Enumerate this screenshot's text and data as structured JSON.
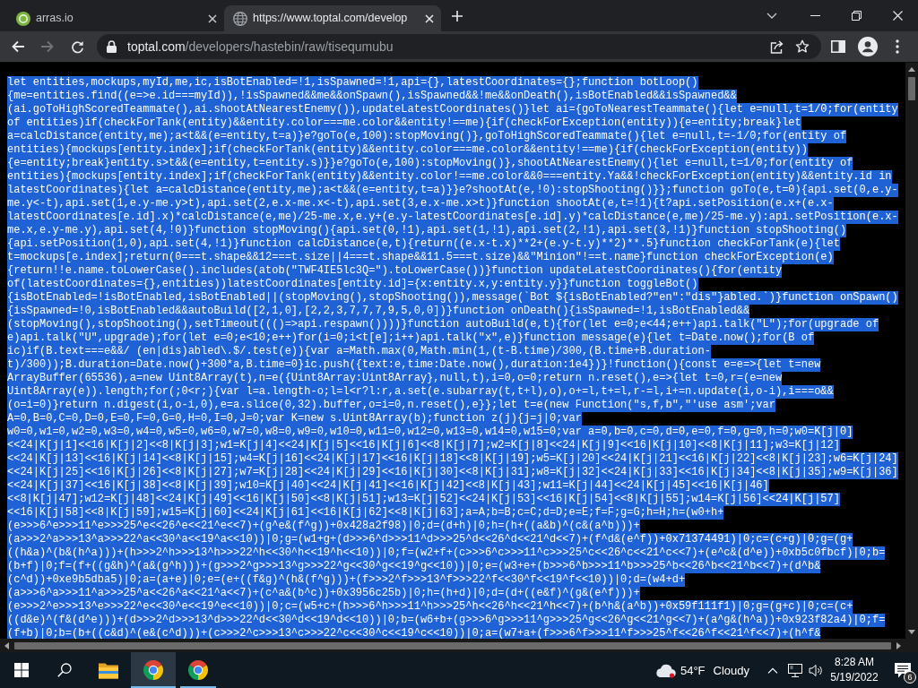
{
  "browser": {
    "tabs": [
      {
        "title": "arras.io",
        "kind": "app",
        "selected": false
      },
      {
        "title": "https://www.toptal.com/develop",
        "kind": "web",
        "selected": true
      }
    ],
    "back": {
      "disabled": false
    },
    "forward": {
      "disabled": true
    },
    "address": {
      "host": "toptal.com",
      "path": "/developers/hastebin/raw/tisequmubu"
    }
  },
  "code": {
    "selected": true,
    "lines": [
      "let entities,mockups,myId,me,ic,isBotEnabled=!1,isSpawned=!1,api={},latestCoordinates={};function botLoop()",
      "{me=entities.find((e=>e.id===myId)),!isSpawned&&me&&onSpawn(),isSpawned&&!me&&onDeath(),isBotEnabled&&isSpawned&&",
      "(ai.goToHighScoredTeammate(),ai.shootAtNearestEnemy()),updateLatestCoordinates()}let ai={goToNearestTeammate(){let e=null,t=1/0;for(entity",
      "of entities)if(checkForTank(entity)&&entity.color===me.color&&entity!==me){if(checkForException(entity)){e=entity;break}let",
      "a=calcDistance(entity,me);a<t&&(e=entity,t=a)}e?goTo(e,100):stopMoving()},goToHighScoredTeammate(){let e=null,t=-1/0;for(entity of",
      "entities){mockups[entity.index];if(checkForTank(entity)&&entity.color===me.color&&entity!==me){if(checkForException(entity))",
      "{e=entity;break}entity.s>t&&(e=entity,t=entity.s)}}e?goTo(e,100):stopMoving()},shootAtNearestEnemy(){let e=null,t=1/0;for(entity of",
      "entities){mockups[entity.index];if(checkForTank(entity)&&entity.color!==me.color&&0===entity.Ya&&!checkForException(entity)&&entity.id in",
      "latestCoordinates){let a=calcDistance(entity,me);a<t&&(e=entity,t=a)}}e?shootAt(e,!0):stopShooting()}};function goTo(e,t=0){api.set(0,e.y-",
      "me.y<-t),api.set(1,e.y-me.y>t),api.set(2,e.x-me.x<-t),api.set(3,e.x-me.x>t)}function shootAt(e,t=!1){t?api.setPosition(e.x+(e.x-",
      "latestCoordinates[e.id].x)*calcDistance(e,me)/25-me.x,e.y+(e.y-latestCoordinates[e.id].y)*calcDistance(e,me)/25-me.y):api.setPosition(e.x-",
      "me.x,e.y-me.y),api.set(4,!0)}function stopMoving(){api.set(0,!1),api.set(1,!1),api.set(2,!1),api.set(3,!1)}function stopShooting()",
      "{api.setPosition(1,0),api.set(4,!1)}function calcDistance(e,t){return((e.x-t.x)**2+(e.y-t.y)**2)**.5}function checkForTank(e){let",
      "t=mockups[e.index];return(0===t.shape&&12===t.size||4===t.shape&&11.5===t.size)&&\"Minion\"!==t.name}function checkForException(e)",
      "{return!!e.name.toLowerCase().includes(atob(\"TWF4IE5lc3Q=\").toLowerCase())}function updateLatestCoordinates(){for(entity",
      "of(latestCoordinates={},entities))latestCoordinates[entity.id]={x:entity.x,y:entity.y}}function toggleBot()",
      "{isBotEnabled=!isBotEnabled,isBotEnabled||(stopMoving(),stopShooting()),message(`Bot ${isBotEnabled?\"en\":\"dis\"}abled.`)}function onSpawn()",
      "{isSpawned=!0,isBotEnabled&&autoBuild([2,1,0],[2,2,3,7,7,7,9,5,0,0])}function onDeath(){isSpawned=!1,isBotEnabled&&",
      "(stopMoving(),stopShooting(),setTimeout((()=>api.respawn())))}function autoBuild(e,t){for(let e=0;e<44;e++)api.talk(\"L\");for(upgrade of",
      "e)api.talk(\"U\",upgrade);for(let e=0;e<10;e++)for(i=0;i<t[e];i++)api.talk(\"x\",e)}function message(e){let t=Date.now();for(B of",
      "ic)if(B.text===e&&/ (en|dis)abled\\.$/.test(e)){var a=Math.max(0,Math.min(1,(t-B.time)/300,(B.time+B.duration-",
      "t)/300));B.duration=Date.now()+300*a,B.time=0}ic.push({text:e,time:Date.now(),duration:1e4})}!function(){const e=e=>{let t=new",
      "ArrayBuffer(65536),a=new Uint8Array(t),n=e({Uint8Array:Uint8Array},null,t),i=0,o=0;return n.reset(),e=>{let t=0,r=(e=new",
      "Uint8Array(e)).length;for(;0<r;){var l=a.length-o;l=l<r?l:r,a.set(e.subarray(t,t+l),o),o+=l,t+=l,r-=l,i+=n.update(i,o-i),i===o&&",
      "(o=i=0)}return n.digest(i,o-i,0),e=a.slice(0,32).buffer,o=i=0,n.reset(),e}};let t=e(new Function(\"s,f,b\",\"'use asm';var",
      "A=0,B=0,C=0,D=0,E=0,F=0,G=0,H=0,I=0,J=0;var K=new s.Uint8Array(b);function z(j){j=j|0;var",
      "w0=0,w1=0,w2=0,w3=0,w4=0,w5=0,w6=0,w7=0,w8=0,w9=0,w10=0,w11=0,w12=0,w13=0,w14=0,w15=0;var a=0,b=0,c=0,d=0,e=0,f=0,g=0,h=0;w0=K[j|0]",
      "<<24|K[j|1]<<16|K[j|2]<<8|K[j|3];w1=K[j|4]<<24|K[j|5]<<16|K[j|6]<<8|K[j|7];w2=K[j|8]<<24|K[j|9]<<16|K[j|10]<<8|K[j|11];w3=K[j|12]",
      "<<24|K[j|13]<<16|K[j|14]<<8|K[j|15];w4=K[j|16]<<24|K[j|17]<<16|K[j|18]<<8|K[j|19];w5=K[j|20]<<24|K[j|21]<<16|K[j|22]<<8|K[j|23];w6=K[j|24]",
      "<<24|K[j|25]<<16|K[j|26]<<8|K[j|27];w7=K[j|28]<<24|K[j|29]<<16|K[j|30]<<8|K[j|31];w8=K[j|32]<<24|K[j|33]<<16|K[j|34]<<8|K[j|35];w9=K[j|36]",
      "<<24|K[j|37]<<16|K[j|38]<<8|K[j|39];w10=K[j|40]<<24|K[j|41]<<16|K[j|42]<<8|K[j|43];w11=K[j|44]<<24|K[j|45]<<16|K[j|46]",
      "<<8|K[j|47];w12=K[j|48]<<24|K[j|49]<<16|K[j|50]<<8|K[j|51];w13=K[j|52]<<24|K[j|53]<<16|K[j|54]<<8|K[j|55];w14=K[j|56]<<24|K[j|57]",
      "<<16|K[j|58]<<8|K[j|59];w15=K[j|60]<<24|K[j|61]<<16|K[j|62]<<8|K[j|63];a=A;b=B;c=C;d=D;e=E;f=F;g=G;h=H;h=(w0+h+",
      "(e>>>6^e>>>11^e>>>25^e<<26^e<<21^e<<7)+(g^e&(f^g))+0x428a2f98)|0;d=(d+h)|0;h=(h+((a&b)^(c&(a^b)))+",
      "(a>>>2^a>>>13^a>>>22^a<<30^a<<19^a<<10))|0;g=(w1+g+(d>>>6^d>>>11^d>>>25^d<<26^d<<21^d<<7)+(f^d&(e^f))+0x71374491)|0;c=(c+g)|0;g=(g+",
      "((h&a)^(b&(h^a)))+(h>>>2^h>>>13^h>>>22^h<<30^h<<19^h<<10))|0;f=(w2+f+(c>>>6^c>>>11^c>>>25^c<<26^c<<21^c<<7)+(e^c&(d^e))+0xb5c0fbcf)|0;b=",
      "(b+f)|0;f=(f+((g&h)^(a&(g^h)))+(g>>>2^g>>>13^g>>>22^g<<30^g<<19^g<<10))|0;e=(w3+e+(b>>>6^b>>>11^b>>>25^b<<26^b<<21^b<<7)+(d^b&",
      "(c^d))+0xe9b5dba5)|0;a=(a+e)|0;e=(e+((f&g)^(h&(f^g)))+(f>>>2^f>>>13^f>>>22^f<<30^f<<19^f<<10))|0;d=(w4+d+",
      "(a>>>6^a>>>11^a>>>25^a<<26^a<<21^a<<7)+(c^a&(b^c))+0x3956c25b)|0;h=(h+d)|0;d=(d+((e&f)^(g&(e^f)))+",
      "(e>>>2^e>>>13^e>>>22^e<<30^e<<19^e<<10))|0;c=(w5+c+(h>>>6^h>>>11^h>>>25^h<<26^h<<21^h<<7)+(b^h&(a^b))+0x59f111f1)|0;g=(g+c)|0;c=(c+",
      "((d&e)^(f&(d^e)))+(d>>>2^d>>>13^d>>>22^d<<30^d<<19^d<<10))|0;b=(w6+b+(g>>>6^g>>>11^g>>>25^g<<26^g<<21^g<<7)+(a^g&(h^a))+0x923f82a4)|0;f=",
      "(f+b)|0;b=(b+((c&d)^(e&(c^d)))+(c>>>2^c>>>13^c>>>22^c<<30^c<<19^c<<10))|0;a=(w7+a+(f>>>6^f>>>11^f>>>25^f<<26^f<<21^f<<7)+(h^f&"
    ]
  },
  "taskbar": {
    "apps": [
      {
        "kind": "folder",
        "selected": false,
        "running": false
      },
      {
        "kind": "browser",
        "selected": true,
        "running": true
      },
      {
        "kind": "browser",
        "selected": false,
        "running": true
      }
    ],
    "weather": {
      "temperature": "54°F",
      "condition": "Cloudy"
    },
    "clock": {
      "time": "8:28 AM",
      "date": "5/19/2022"
    },
    "notifications": {
      "count": "6"
    }
  }
}
